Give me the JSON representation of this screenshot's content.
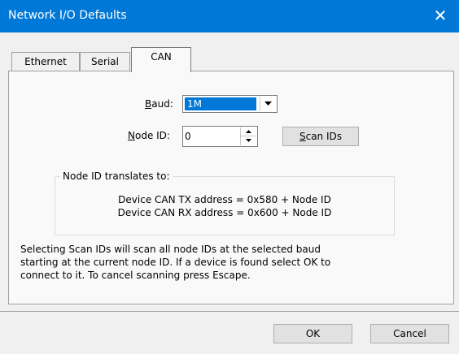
{
  "window": {
    "title": "Network I/O Defaults",
    "close_glyph": "✕"
  },
  "tabs": [
    {
      "label": "Ethernet",
      "active": false
    },
    {
      "label": "Serial",
      "active": false
    },
    {
      "label": "CAN",
      "active": true
    }
  ],
  "can": {
    "baud_label": "Baud:",
    "baud_value": "1M",
    "node_id_label": "Node ID:",
    "node_id_value": "0",
    "scan_button": "Scan IDs"
  },
  "translation_group": {
    "title": "Node ID translates to:",
    "lines": [
      "Device CAN TX address = 0x580 + Node ID",
      "Device CAN RX address = 0x600 + Node ID"
    ]
  },
  "help_text": [
    "Selecting Scan IDs will scan all node IDs at the selected baud",
    "starting at the current node ID.  If a device is found select OK to",
    "connect to it.  To cancel scanning press Escape."
  ],
  "footer": {
    "ok": "OK",
    "cancel": "Cancel"
  },
  "colors": {
    "titlebar": "#0078d7",
    "selection": "#0078d7",
    "dialog_bg": "#f0f0f0",
    "panel_bg": "#f9f9f9"
  }
}
